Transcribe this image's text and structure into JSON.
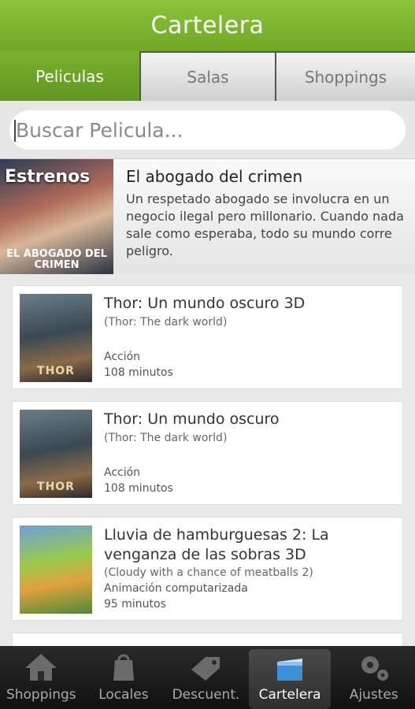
{
  "header": {
    "title": "Cartelera"
  },
  "tabs": [
    {
      "label": "Peliculas"
    },
    {
      "label": "Salas"
    },
    {
      "label": "Shoppings"
    }
  ],
  "search": {
    "placeholder": "Buscar Pelicula..."
  },
  "featured": {
    "badge": "Estrenos",
    "poster_text": "EL ABOGADO DEL CRIMEN",
    "title": "El abogado del crimen",
    "description": "Un respetado abogado se involucra en un negocio ilegal pero millonario. Cuando nada sale como esperaba, todo su mundo corre peligro."
  },
  "movies": [
    {
      "poster_text": "THOR",
      "title": "Thor: Un mundo oscuro 3D",
      "original": "(Thor: The dark world)",
      "genre": "Acción",
      "duration": "108 minutos"
    },
    {
      "poster_text": "THOR",
      "title": "Thor: Un mundo oscuro",
      "original": "(Thor: The dark world)",
      "genre": "Acción",
      "duration": "108 minutos"
    },
    {
      "poster_text": "",
      "title": "Lluvia de hamburguesas 2: La venganza de las sobras 3D",
      "original": "(Cloudy with a chance of meatballs 2)",
      "genre": "Animación computarizada",
      "duration": "95 minutos"
    }
  ],
  "bottom_nav": [
    {
      "label": "Shoppings",
      "icon": "home-icon"
    },
    {
      "label": "Locales",
      "icon": "shopping-bag-icon"
    },
    {
      "label": "Descuent.",
      "icon": "price-tag-icon"
    },
    {
      "label": "Cartelera",
      "icon": "film-board-icon"
    },
    {
      "label": "Ajustes",
      "icon": "gears-icon"
    }
  ],
  "colors": {
    "accent": "#7ab52e",
    "nav_bg": "#1c1c1c"
  }
}
